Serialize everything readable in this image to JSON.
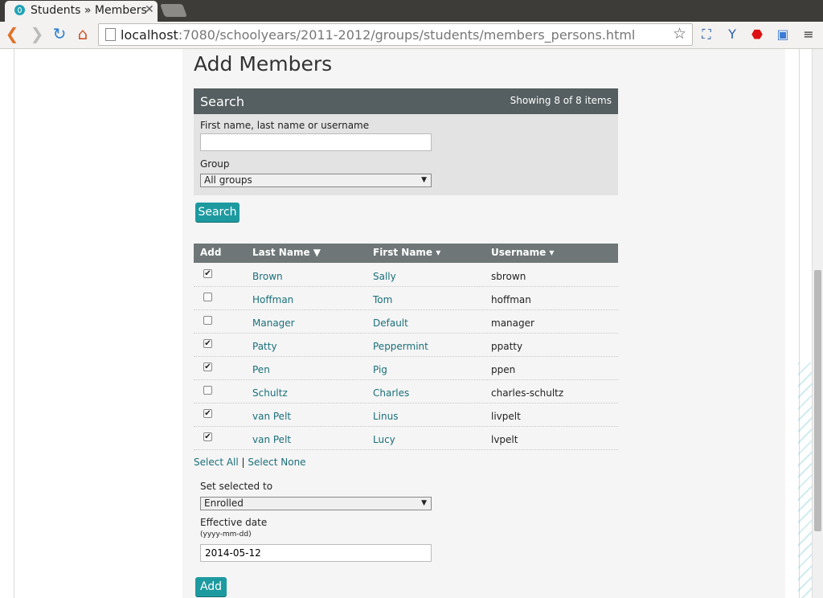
{
  "browser": {
    "tab_title": "Students » Members",
    "tab_close": "✕",
    "url_host": "localhost",
    "url_rest": ":7080/schoolyears/2011-2012/groups/students/members_persons.html"
  },
  "page": {
    "heading": "Add Members"
  },
  "search": {
    "title": "Search",
    "showing": "Showing 8 of 8 items",
    "name_label": "First name, last name or username",
    "name_value": "",
    "group_label": "Group",
    "group_selected": "All groups",
    "button": "Search"
  },
  "table": {
    "headers": {
      "add": "Add",
      "last_name": "Last Name ▼",
      "first_name": "First Name ▾",
      "username": "Username ▾"
    },
    "rows": [
      {
        "checked": "✔",
        "last": "Brown",
        "first": "Sally",
        "username": "sbrown"
      },
      {
        "checked": "",
        "last": "Hoffman",
        "first": "Tom",
        "username": "hoffman"
      },
      {
        "checked": "",
        "last": "Manager",
        "first": "Default",
        "username": "manager"
      },
      {
        "checked": "✔",
        "last": "Patty",
        "first": "Peppermint",
        "username": "ppatty"
      },
      {
        "checked": "✔",
        "last": "Pen",
        "first": "Pig",
        "username": "ppen"
      },
      {
        "checked": "",
        "last": "Schultz",
        "first": "Charles",
        "username": "charles-schultz"
      },
      {
        "checked": "✔",
        "last": "van Pelt",
        "first": "Linus",
        "username": "livpelt"
      },
      {
        "checked": "✔",
        "last": "van Pelt",
        "first": "Lucy",
        "username": "lvpelt"
      }
    ]
  },
  "selection": {
    "select_all": "Select All",
    "separator": "|",
    "select_none": "Select None"
  },
  "bulk": {
    "set_label": "Set selected to",
    "set_value": "Enrolled",
    "date_label": "Effective date",
    "date_hint": "(yyyy-mm-dd)",
    "date_value": "2014-05-12",
    "add_button": "Add"
  },
  "colors": {
    "accent": "#1d9aa0",
    "link": "#1a6f7a",
    "header_dark": "#555e60",
    "table_header": "#6e7677"
  }
}
